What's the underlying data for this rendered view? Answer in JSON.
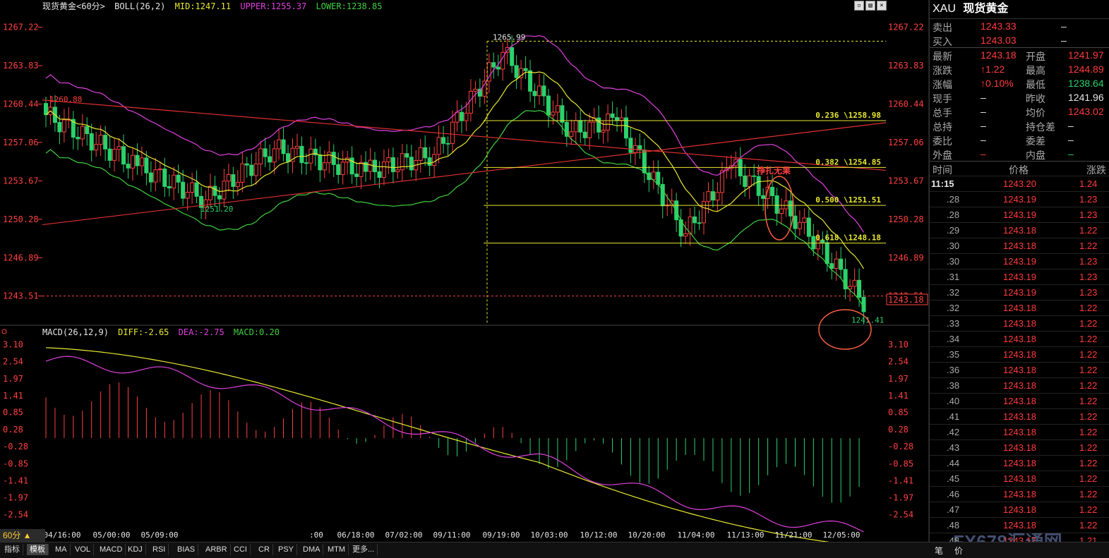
{
  "header": {
    "instrument": "现货黄金<60分>",
    "boll_label": "BOLL(26,2)",
    "mid": "MID:1247.11",
    "upper": "UPPER:1255.37",
    "lower": "LOWER:1238.85"
  },
  "macd_header": {
    "label": "MACD(26,12,9)",
    "diff": "DIFF:-2.65",
    "dea": "DEA:-2.75",
    "macd": "MACD:0.20"
  },
  "price_axis_left": [
    "1267.22",
    "1263.83",
    "1260.44",
    "1257.06",
    "1253.67",
    "1250.28",
    "1246.89",
    "1243.51"
  ],
  "price_axis_right": [
    "1267.22",
    "1263.83",
    "1260.44",
    "1257.06",
    "1253.67",
    "1250.28",
    "1246.89",
    "1243.51"
  ],
  "current_price_tag": "1243.18",
  "macd_axis": [
    "3.10",
    "2.54",
    "1.97",
    "1.41",
    "0.85",
    "0.28",
    "-0.28",
    "-0.85",
    "-1.41",
    "-1.97",
    "-2.54"
  ],
  "time_axis": [
    "04/16:00",
    "05/00:00",
    "05/09:00",
    ":00",
    "06/18:00",
    "07/02:00",
    "09/11:00",
    "09/19:00",
    "10/03:00",
    "10/12:00",
    "10/20:00",
    "11/04:00",
    "11/13:00",
    "11/21:00",
    "12/05:00"
  ],
  "annotations": {
    "high": "1265.99",
    "left_start": "1260.88",
    "low1": "1251.20",
    "low2": "1241.41",
    "fib236": "0.236 \\1258.98",
    "fib382": "0.382 \\1254.85",
    "fib500": "0.500 \\1251.51",
    "fib618": "0.618 \\1248.18",
    "note": "挣扎无果"
  },
  "chart_data": {
    "type": "candlestick",
    "title": "现货黄金<60分>",
    "ylim": [
      1241.0,
      1268.5
    ],
    "fib_levels": [
      1258.98,
      1254.85,
      1251.51,
      1248.18
    ],
    "macd_ylim": [
      -2.9,
      3.3
    ]
  },
  "quote": {
    "code": "XAU",
    "name": "现货黄金",
    "sell_label": "卖出",
    "sell_value": "1243.33",
    "sell_vol": "–",
    "buy_label": "买入",
    "buy_value": "1243.03",
    "buy_vol": "–",
    "rows": [
      {
        "l1": "最新",
        "v1": "1243.18",
        "c1": "red",
        "l2": "开盘",
        "v2": "1241.97",
        "c2": "red"
      },
      {
        "l1": "涨跌",
        "v1": "↑1.22",
        "c1": "red",
        "l2": "最高",
        "v2": "1244.89",
        "c2": "red"
      },
      {
        "l1": "涨幅",
        "v1": "↑0.10%",
        "c1": "red",
        "l2": "最低",
        "v2": "1238.64",
        "c2": "grn"
      },
      {
        "l1": "现手",
        "v1": "–",
        "c1": "wht",
        "l2": "昨收",
        "v2": "1241.96",
        "c2": "wht"
      },
      {
        "l1": "总手",
        "v1": "–",
        "c1": "wht",
        "l2": "均价",
        "v2": "1243.02",
        "c2": "red"
      },
      {
        "l1": "总持",
        "v1": "–",
        "c1": "wht",
        "l2": "持仓差",
        "v2": "–",
        "c2": "wht"
      },
      {
        "l1": "委比",
        "v1": "–",
        "c1": "wht",
        "l2": "委差",
        "v2": "–",
        "c2": "wht"
      },
      {
        "l1": "外盘",
        "v1": "–",
        "c1": "red",
        "l2": "内盘",
        "v2": "–",
        "c2": "grn"
      }
    ],
    "ticks_header": {
      "time": "时间",
      "price": "价格",
      "change": "涨跌"
    },
    "ticks": [
      {
        "t": "11:15",
        "p": "1243.20",
        "c": "1.24"
      },
      {
        "t": ".28",
        "p": "1243.19",
        "c": "1.23"
      },
      {
        "t": ".28",
        "p": "1243.19",
        "c": "1.23"
      },
      {
        "t": ".29",
        "p": "1243.18",
        "c": "1.22"
      },
      {
        "t": ".30",
        "p": "1243.18",
        "c": "1.22"
      },
      {
        "t": ".30",
        "p": "1243.19",
        "c": "1.23"
      },
      {
        "t": ".31",
        "p": "1243.19",
        "c": "1.23"
      },
      {
        "t": ".32",
        "p": "1243.19",
        "c": "1.23"
      },
      {
        "t": ".32",
        "p": "1243.18",
        "c": "1.22"
      },
      {
        "t": ".33",
        "p": "1243.18",
        "c": "1.22"
      },
      {
        "t": ".34",
        "p": "1243.18",
        "c": "1.22"
      },
      {
        "t": ".35",
        "p": "1243.18",
        "c": "1.22"
      },
      {
        "t": ".36",
        "p": "1243.18",
        "c": "1.22"
      },
      {
        "t": ".38",
        "p": "1243.18",
        "c": "1.22"
      },
      {
        "t": ".40",
        "p": "1243.18",
        "c": "1.22"
      },
      {
        "t": ".41",
        "p": "1243.18",
        "c": "1.22"
      },
      {
        "t": ".42",
        "p": "1243.18",
        "c": "1.22"
      },
      {
        "t": ".43",
        "p": "1243.18",
        "c": "1.22"
      },
      {
        "t": ".44",
        "p": "1243.18",
        "c": "1.22"
      },
      {
        "t": ".45",
        "p": "1243.18",
        "c": "1.22"
      },
      {
        "t": ".46",
        "p": "1243.18",
        "c": "1.22"
      },
      {
        "t": ".47",
        "p": "1243.18",
        "c": "1.22"
      },
      {
        "t": ".48",
        "p": "1243.18",
        "c": "1.22"
      },
      {
        "t": ".48",
        "p": "1243.17",
        "c": "1.21"
      }
    ]
  },
  "toolbar": {
    "period": "60分 ▲",
    "buttons": [
      "指标",
      "模板",
      "MA",
      "VOL",
      "MACD",
      "KDJ",
      "RSI",
      "BIAS",
      "ARBR",
      "CCI",
      "CR",
      "PSY",
      "DMA",
      "MTM",
      "更多..."
    ]
  },
  "quote_bottom": {
    "b1": "笔",
    "b2": "价"
  },
  "watermark": "FX678汇通网"
}
